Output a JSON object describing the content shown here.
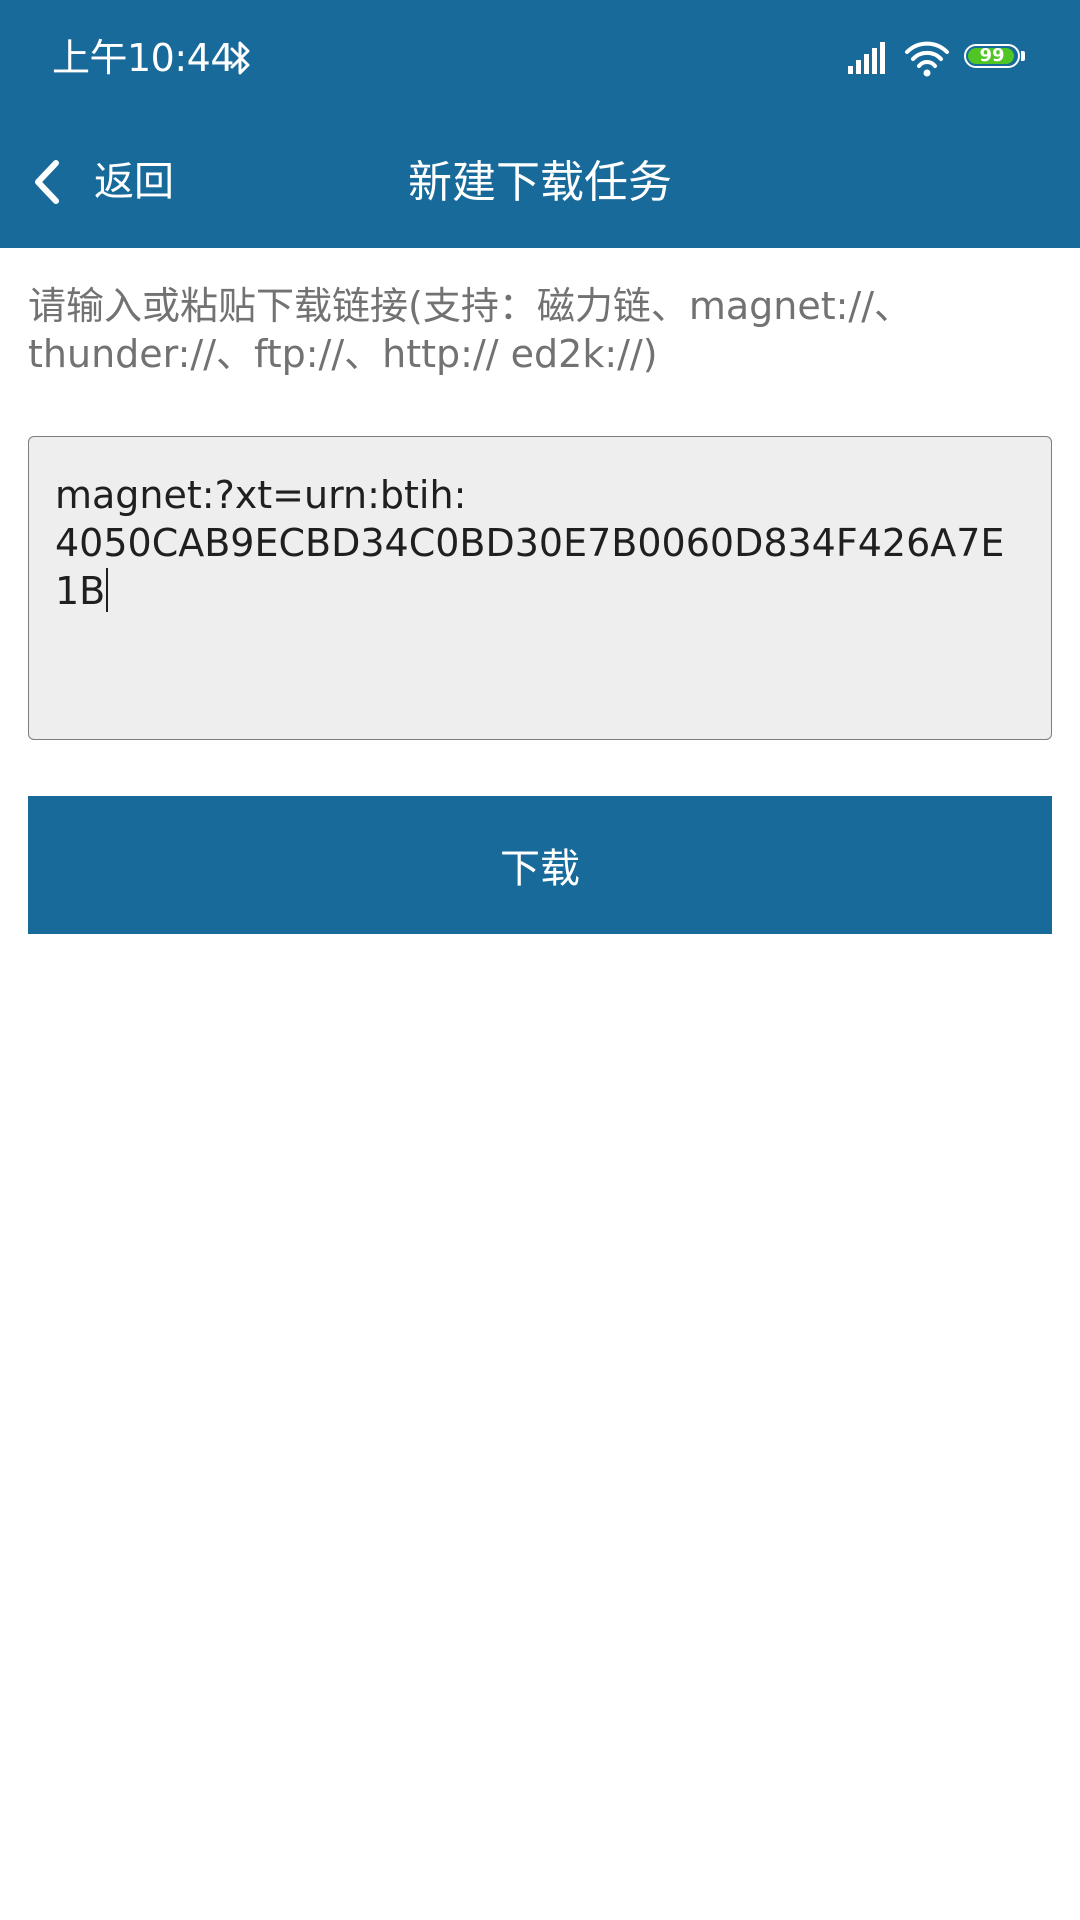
{
  "status_bar": {
    "time": "上午10:44",
    "battery_level": "99",
    "icons": [
      "bluetooth-icon",
      "signal-icon",
      "wifi-icon",
      "battery-icon"
    ],
    "battery_fill_color": "#4fc623"
  },
  "app_bar": {
    "back_label": "返回",
    "title": "新建下载任务",
    "back_icon": "chevron-left-icon",
    "background_color": "#176a99"
  },
  "form": {
    "hint": "请输入或粘贴下载链接(支持：磁力链、magnet://、thunder://、ftp://、http:// ed2k://)",
    "link_value": "magnet:?xt=urn:btih:\n4050CAB9ECBD34C0BD30E7B0060D834F426A7E1B",
    "download_label": "下载"
  }
}
